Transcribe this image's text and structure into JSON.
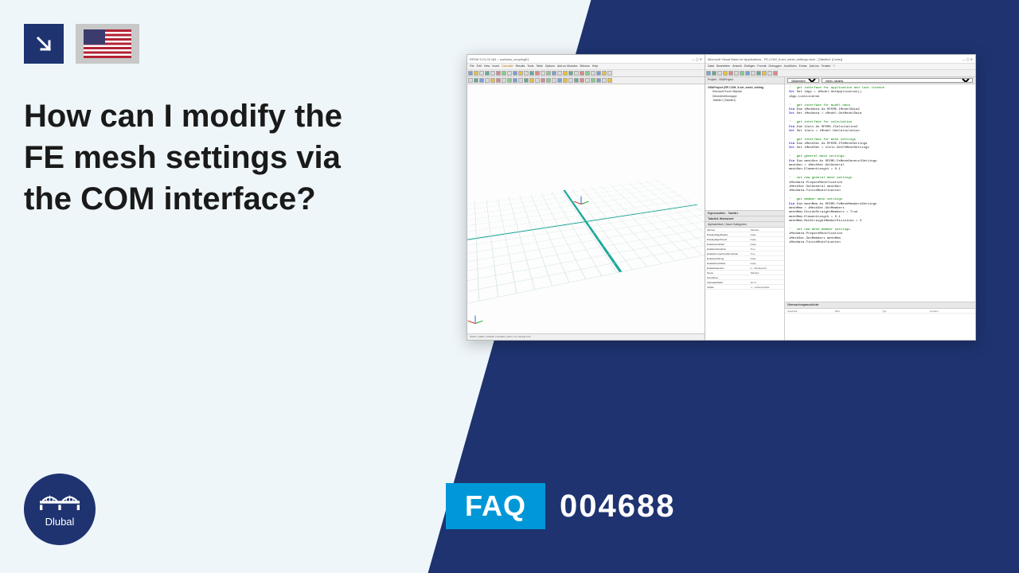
{
  "question": "How can I modify the FE mesh settings via the COM interface?",
  "faq": {
    "label": "FAQ",
    "number": "004688"
  },
  "brand": "Dlubal",
  "rfem": {
    "title": "RFEM 5.21.02 x64 – surfaces_coupling01",
    "menu": [
      "File",
      "Edit",
      "View",
      "Insert",
      "Calculate",
      "Results",
      "Tools",
      "Table",
      "Options",
      "Add-on Modules",
      "Window",
      "Help"
    ],
    "menu_hl_index": 4,
    "status": "SNAP | GRID | OSNAP | GLINES | DXF | CS: Global XYZ"
  },
  "vba": {
    "title": "Microsoft Visual Basic for Applications - FE-COM_5-set_mesh_settings.xlsm - [Tabelle1 (Code)]",
    "menu": [
      "Datei",
      "Bearbeiten",
      "Ansicht",
      "Einfügen",
      "Format",
      "Debuggen",
      "Ausführen",
      "Extras",
      "Add-Ins",
      "Fenster",
      "?"
    ],
    "proj_header": "Projekt - VBAProject",
    "tree_root": "VBAProject (RF-COM_5-set_mesh_setting",
    "tree_nodes": [
      "Microsoft Excel Objekte",
      "  DieseArbeitsmappe",
      "  Tabelle1 (Tabelle1)"
    ],
    "prop_header": "Eigenschaften - Tabelle1",
    "prop_sub": "Tabelle1 Worksheet",
    "prop_tabs": "Alphabetisch | Nach Kategorien",
    "props": [
      [
        "(Name)",
        "Tabelle1"
      ],
      [
        "DisplayPageBreaks",
        "False"
      ],
      [
        "DisplayRightToLeft",
        "False"
      ],
      [
        "EnableAutoFilter",
        "False"
      ],
      [
        "EnableCalculation",
        "True"
      ],
      [
        "EnableFormatConditionsCalc",
        "True"
      ],
      [
        "EnableOutlining",
        "False"
      ],
      [
        "EnablePivotTable",
        "False"
      ],
      [
        "EnableSelection",
        "0 - xlNoRestrict"
      ],
      [
        "Name",
        "Tabelle1"
      ],
      [
        "ScrollArea",
        ""
      ],
      [
        "StandardWidth",
        "10.71"
      ],
      [
        "Visible",
        "-1 - xlSheetVisible"
      ]
    ],
    "combo_left": "(Allgemein)",
    "combo_right": "mesh_params",
    "immediate": "Überwachungsausdrücke",
    "imm_cols": [
      "Ausdruck",
      "Wert",
      "Typ",
      "Kontext"
    ],
    "code": {
      "c1": "'   get interface for application and lock licence",
      "l1a": "Set iApp = iModel.GetApplication()",
      "l1b": "iApp.LockLicense",
      "c2": "'   get interface for model data",
      "l2a": "Dim iModdata As RFEM5.IModelData2",
      "l2b": "Set iModdata = iModel.GetModelData",
      "c3": "'   get interface for calculation",
      "l3a": "Dim iCalc As RFEM5.ICalculation2",
      "l3b": "Set iCalc = iModel.GetCalculation",
      "c4": "'   get interface for mesh settings",
      "l4a": "Dim iMeshSet As RFEM5.IFeMeshSettings",
      "l4b": "Set iMeshSet = iCalc.GetFeMeshSettings",
      "c5": "'   get general mesh settings",
      "l5a": "Dim meshGen As RFEM5.FeMeshGeneralSettings",
      "l5b": "meshGen = iMeshSet.GetGeneral",
      "l5c": "meshGen.ElementLength = 0.1",
      "c6": "'   set new general mesh settings",
      "l6a": "iModdata.PrepareModification",
      "l6b": "iMeshSet.SetGeneral meshGen",
      "l6c": "iModdata.FinishModification",
      "c7": "'   get member mesh settings",
      "l7a": "Dim meshMem As RFEM5.FeMeshMembersSettings",
      "l7b": "meshMem = iMeshSet.GetMembers",
      "l7c": "meshMem.DivideStraightMembers = True",
      "l7d": "meshMem.ElementLength = 0.1",
      "l7e": "meshMem.MinStraightMemberDivisions = 3",
      "c8": "'   set new mesh member settings",
      "l8a": "iModdata.PrepareModification",
      "l8b": "iMeshSet.SetMembers meshMem",
      "l8c": "iModdata.FinishModification"
    }
  }
}
